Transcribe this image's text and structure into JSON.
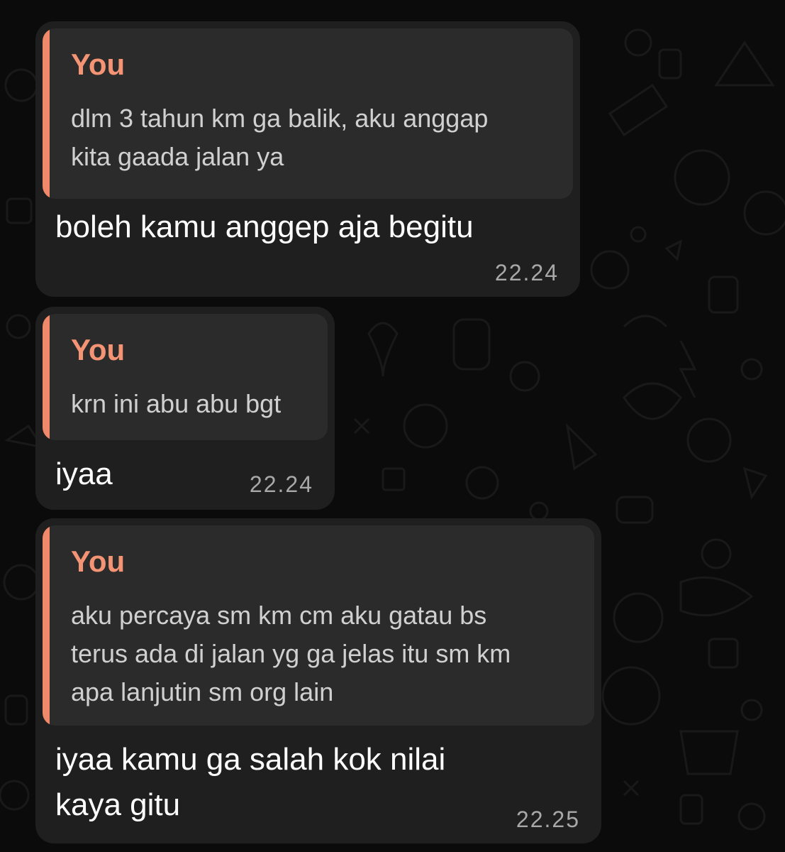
{
  "chat": {
    "messages": [
      {
        "reply_to": {
          "author": "You",
          "text": "dlm 3 tahun km ga balik, aku anggap\nkita gaada jalan ya"
        },
        "text": "boleh kamu anggep aja begitu",
        "time": "22.24"
      },
      {
        "reply_to": {
          "author": "You",
          "text": "krn ini abu abu bgt"
        },
        "text": "iyaa",
        "time": "22.24"
      },
      {
        "reply_to": {
          "author": "You",
          "text": "aku percaya sm km cm aku gatau bs\nterus ada di jalan yg ga jelas itu sm km\napa lanjutin sm org lain"
        },
        "text": "iyaa kamu ga salah kok nilai\nkaya gitu",
        "time": "22.25"
      }
    ]
  },
  "colors": {
    "background": "#0b0b0b",
    "bubble": "#1f1f1f",
    "quote_background": "#2b2b2b",
    "quote_accent": "#f0896a",
    "quote_author": "#f49474"
  }
}
